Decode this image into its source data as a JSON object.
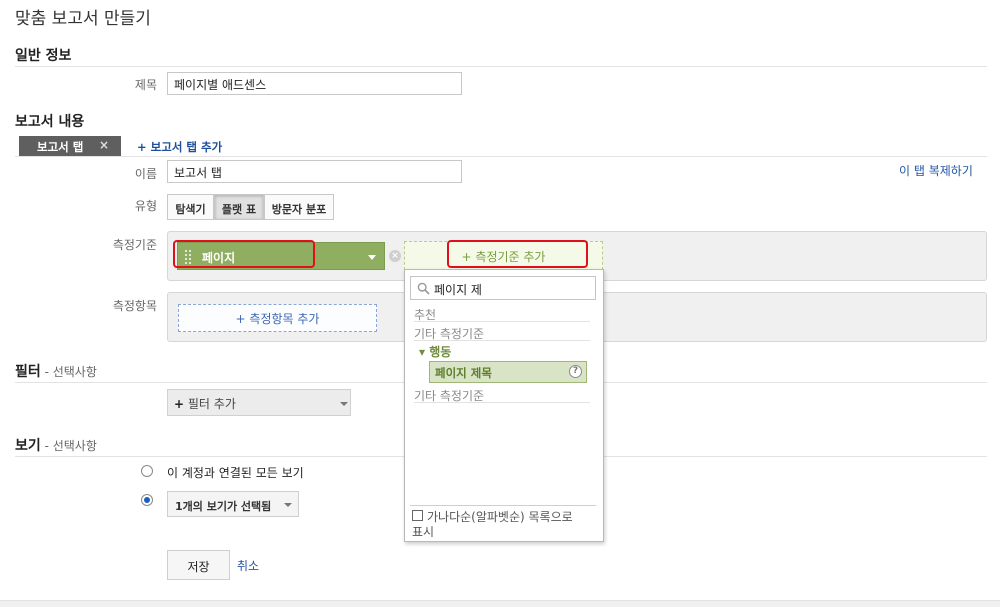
{
  "page_title": "맞춤 보고서 만들기",
  "general": {
    "section_title": "일반 정보",
    "title_label": "제목",
    "title_value": "페이지별 애드센스"
  },
  "content": {
    "section_title": "보고서 내용",
    "tab_chip_label": "보고서 탭",
    "tab_close_glyph": "×",
    "add_tab_plus": "+",
    "add_tab_label": "보고서 탭 추가",
    "name_label": "이름",
    "name_value": "보고서 탭",
    "duplicate_tab_link": "이 탭 복제하기",
    "type_label": "유형",
    "type_options": [
      "탐색기",
      "플랫 표",
      "방문자 분포"
    ],
    "dimension_label": "측정기준",
    "dimension_chip": "페이지",
    "add_dimension": "+ 측정기준 추가",
    "metric_label": "측정항목",
    "add_metric": "+ 측정항목 추가"
  },
  "dropdown": {
    "search_value": "페이지 제",
    "recommended": "추천",
    "other_dimensions_1": "기타 측정기준",
    "group_toggle": "▾",
    "group_name": "행동",
    "item_label": "페이지 제목",
    "help_glyph": "?",
    "other_dimensions_2": "기타 측정기준",
    "alpha_sort_label_1": "가나다순(알파벳순) 목록으로",
    "alpha_sort_label_2": "표시"
  },
  "filter": {
    "section_title": "필터",
    "optional": " - 선택사항",
    "plus": "+",
    "add_filter": "필터 추가"
  },
  "view": {
    "section_title": "보기",
    "optional": " - 선택사항",
    "all_views_label": "이 계정과 연결된 모든 보기",
    "selected_views": "1개의 보기가 선택됨"
  },
  "actions": {
    "save": "저장",
    "cancel": "취소"
  },
  "colors": {
    "dimension_green": "#8fae61",
    "link_blue": "#2456a8",
    "highlight_red": "#e0101a"
  }
}
